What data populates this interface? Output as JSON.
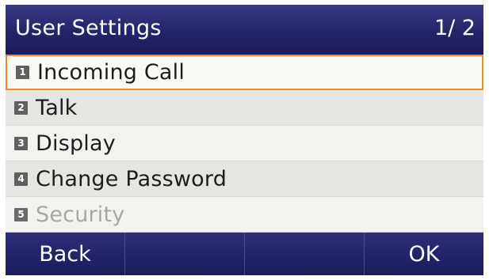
{
  "header": {
    "title": "User Settings",
    "page_indicator": "1/ 2"
  },
  "menu": {
    "items": [
      {
        "number": "1",
        "label": "Incoming Call"
      },
      {
        "number": "2",
        "label": "Talk"
      },
      {
        "number": "3",
        "label": "Display"
      },
      {
        "number": "4",
        "label": "Change Password"
      },
      {
        "number": "5",
        "label": "Security"
      }
    ]
  },
  "softkeys": {
    "key1": "Back",
    "key2": "",
    "key3": "",
    "key4": "OK"
  },
  "colors": {
    "title_bar": "#24246a",
    "selection_border": "#f08a25"
  }
}
